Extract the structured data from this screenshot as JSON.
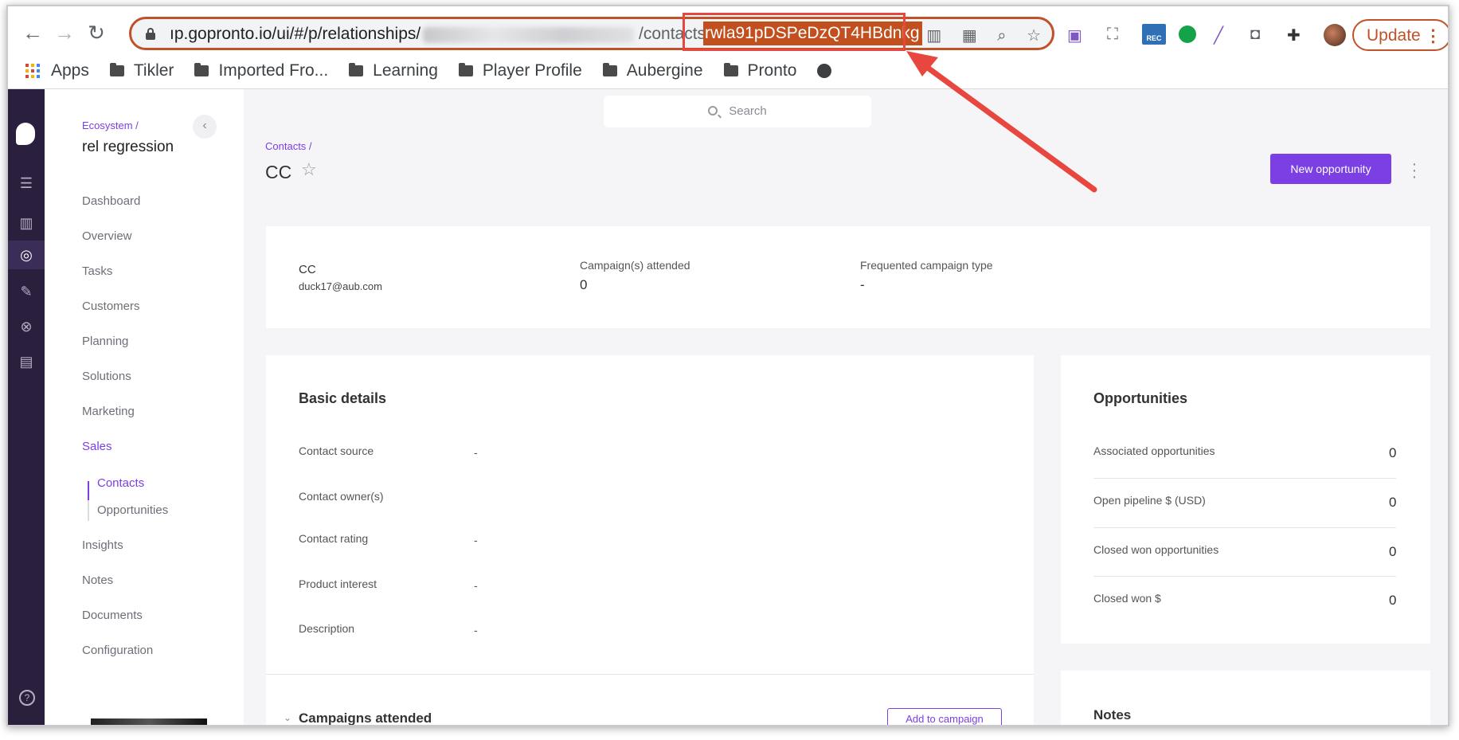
{
  "browser": {
    "url_prefix": "ıp.gopronto.io/ui/#/p/relationships/",
    "url_suffix": "/contacts/",
    "url_highlight": "rwla91pDSPeDzQT4HBdnkg",
    "update_label": "Update",
    "extension_badge": "REC",
    "bookmarks": [
      {
        "label": "Apps",
        "icon": "apps-grid-icon"
      },
      {
        "label": "Tikler",
        "icon": "folder-icon"
      },
      {
        "label": "Imported Fro...",
        "icon": "folder-icon"
      },
      {
        "label": "Learning",
        "icon": "folder-icon"
      },
      {
        "label": "Player Profile",
        "icon": "folder-icon"
      },
      {
        "label": "Aubergine",
        "icon": "folder-icon"
      },
      {
        "label": "Pronto",
        "icon": "folder-icon"
      }
    ]
  },
  "sidebar": {
    "breadcrumb": "Ecosystem /",
    "workspace": "rel regression",
    "items": [
      "Dashboard",
      "Overview",
      "Tasks",
      "Customers",
      "Planning",
      "Solutions",
      "Marketing",
      "Sales"
    ],
    "sub_items": [
      "Contacts",
      "Opportunities"
    ],
    "items_after": [
      "Insights",
      "Notes",
      "Documents",
      "Configuration"
    ],
    "active_item": "Sales",
    "active_sub_item": "Contacts"
  },
  "main": {
    "search_placeholder": "Search",
    "breadcrumb": "Contacts /",
    "title": "CC",
    "new_opportunity": "New opportunity",
    "summary": {
      "name": "CC",
      "email": "duck17@aub.com",
      "campaigns_label": "Campaign(s) attended",
      "campaigns_value": "0",
      "frequented_label": "Frequented campaign type",
      "frequented_value": "-"
    },
    "basic_details": {
      "title": "Basic details",
      "rows": [
        {
          "label": "Contact source",
          "value": "-"
        },
        {
          "label": "Contact owner(s)",
          "value": ""
        },
        {
          "label": "Contact rating",
          "value": "-"
        },
        {
          "label": "Product interest",
          "value": "-"
        },
        {
          "label": "Description",
          "value": "-"
        }
      ]
    },
    "opportunities": {
      "title": "Opportunities",
      "rows": [
        {
          "label": "Associated opportunities",
          "value": "0"
        },
        {
          "label": "Open pipeline $ (USD)",
          "value": "0"
        },
        {
          "label": "Closed won opportunities",
          "value": "0"
        },
        {
          "label": "Closed won $",
          "value": "0"
        }
      ]
    },
    "campaigns_attended": "Campaigns attended",
    "add_to_campaign": "Add to campaign",
    "notes_title": "Notes"
  },
  "colors": {
    "accent": "#7b3fe4",
    "rail": "#2a1f3d",
    "annotation": "#e8473f",
    "url_highlight": "#c1501e"
  }
}
